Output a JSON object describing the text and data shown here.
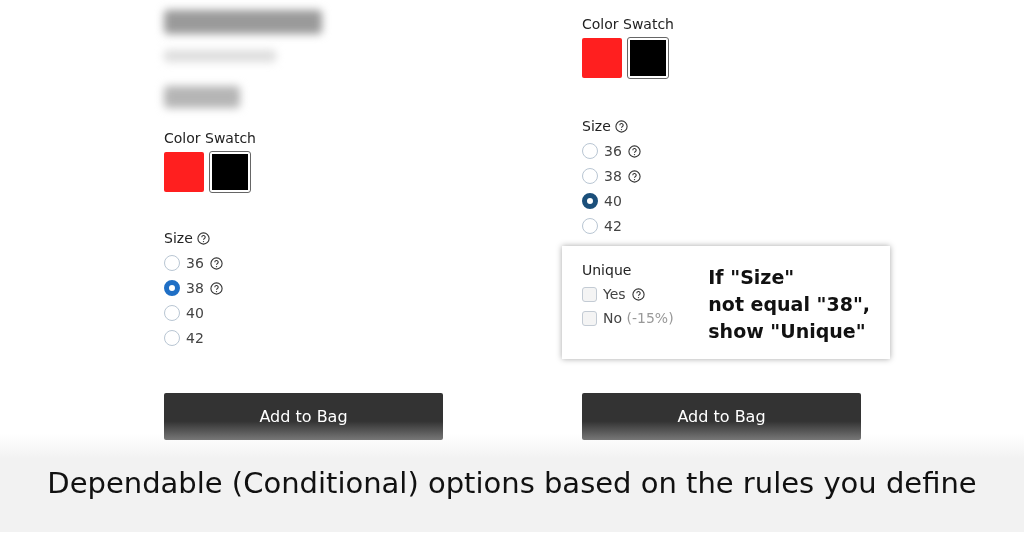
{
  "panels": [
    {
      "product_header": true,
      "color_label": "Color Swatch",
      "swatches": [
        {
          "color": "#ff1f1f",
          "selected": false
        },
        {
          "color": "#000000",
          "selected": true
        }
      ],
      "size_label": "Size",
      "sizes": [
        {
          "label": "36",
          "help": true,
          "selected": false
        },
        {
          "label": "38",
          "help": true,
          "selected": true
        },
        {
          "label": "40",
          "help": false,
          "selected": false
        },
        {
          "label": "42",
          "help": false,
          "selected": false
        }
      ],
      "button": "Add to Bag"
    },
    {
      "product_header": false,
      "color_label": "Color Swatch",
      "swatches": [
        {
          "color": "#ff1f1f",
          "selected": false
        },
        {
          "color": "#000000",
          "selected": true
        }
      ],
      "size_label": "Size",
      "sizes": [
        {
          "label": "36",
          "help": true,
          "selected": false
        },
        {
          "label": "38",
          "help": true,
          "selected": false
        },
        {
          "label": "40",
          "help": false,
          "selected": true
        },
        {
          "label": "42",
          "help": false,
          "selected": false
        }
      ],
      "conditional": {
        "label": "Unique",
        "options": [
          {
            "label": "Yes",
            "help": true,
            "checked": false
          },
          {
            "label": "No",
            "note": "(-15%)",
            "help": false,
            "checked": false
          }
        ],
        "annotation": [
          "If \"Size\"",
          "not equal \"38\",",
          "show \"Unique\""
        ]
      },
      "button": "Add to Bag"
    }
  ],
  "caption": "Dependable (Conditional) options based on the rules you define"
}
